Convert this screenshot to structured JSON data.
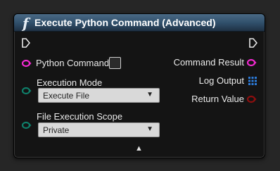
{
  "node": {
    "title": "Execute Python Command (Advanced)",
    "title_icon": "f",
    "inputs": {
      "python_command": "Python Command",
      "execution_mode": "Execution Mode",
      "execution_mode_value": "Execute File",
      "file_execution_scope": "File Execution Scope",
      "file_execution_scope_value": "Private"
    },
    "outputs": {
      "command_result": "Command Result",
      "log_output": "Log Output",
      "return_value": "Return Value"
    }
  },
  "colors": {
    "string_pin": "#f12ad0",
    "enum_pin": "#0f7f6a",
    "array_pin": "#2b79d6",
    "bool_pin": "#8f0e0e"
  },
  "icons": [
    "function-icon",
    "exec-pin-icon",
    "dropdown-arrow-icon",
    "collapse-arrow-icon"
  ]
}
